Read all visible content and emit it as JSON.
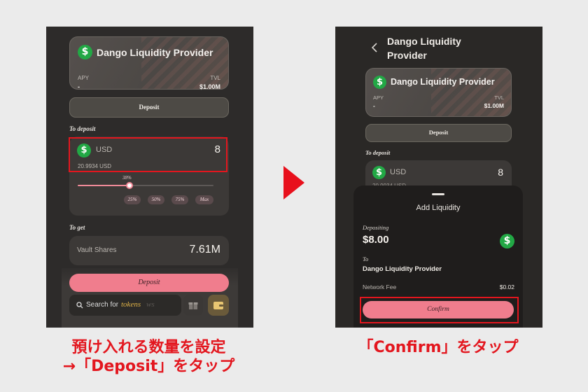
{
  "left": {
    "vault_card": {
      "title": "Dango Liquidity Provider",
      "apy_label": "APY",
      "apy_value": "-",
      "tvl_label": "TVL",
      "tvl_value": "$1.00M",
      "coin_symbol": "$"
    },
    "deposit_tab_label": "Deposit",
    "to_deposit_label": "To deposit",
    "input": {
      "token": "USD",
      "amount": "8",
      "balance": "20.9934 USD"
    },
    "slider": {
      "percent_label": "38%",
      "value": 0.38
    },
    "chips": [
      "25%",
      "50%",
      "75%",
      "Max"
    ],
    "to_get_label": "To get",
    "vault_shares": {
      "label": "Vault Shares",
      "value": "7.61M"
    },
    "deposit_button_label": "Deposit",
    "search": {
      "prefix": "Search for",
      "highlight": "tokens",
      "faded": "ws"
    }
  },
  "right": {
    "page_title": "Dango Liquidity Provider",
    "vault_card": {
      "title": "Dango Liquidity Provider",
      "apy_label": "APY",
      "apy_value": "-",
      "tvl_label": "TVL",
      "tvl_value": "$1.00M",
      "coin_symbol": "$"
    },
    "deposit_tab_label": "Deposit",
    "to_deposit_label": "To deposit",
    "input": {
      "token": "USD",
      "amount": "8",
      "balance_partial": "20.9934 USD"
    },
    "sheet": {
      "title": "Add Liquidity",
      "depositing_label": "Depositing",
      "amount": "$8.00",
      "to_label": "To",
      "to_value": "Dango Liquidity Provider",
      "fee_label": "Network Fee",
      "fee_value": "$0.02",
      "confirm_label": "Confirm"
    }
  },
  "captions": {
    "left": [
      "預け入れる数量を設定",
      "→「Deposit」をタップ"
    ],
    "right": "「Confirm」をタップ"
  },
  "colors": {
    "accent_red": "#e3161e",
    "pink_button": "#f07d8d",
    "coin_green": "#22a845",
    "arrow_red": "#e8101c"
  }
}
